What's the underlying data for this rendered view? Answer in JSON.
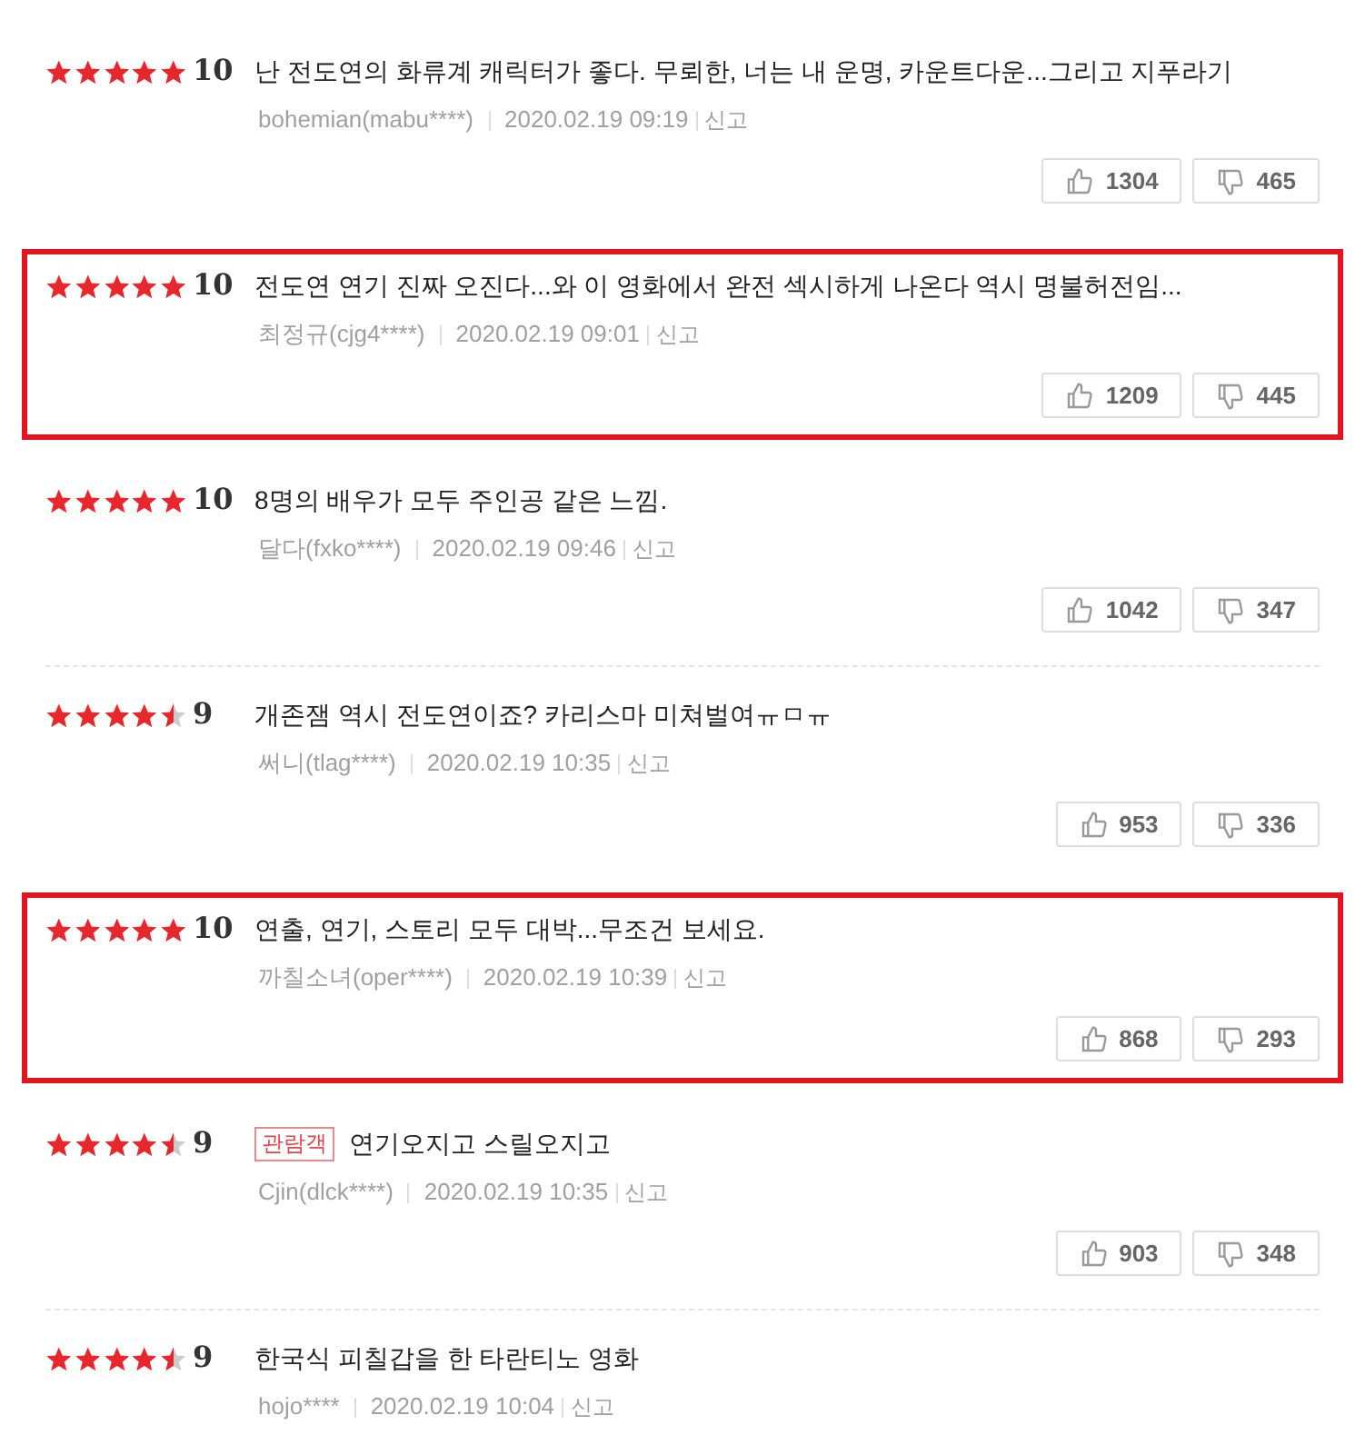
{
  "reviews": [
    {
      "stars": 5,
      "score": "10",
      "highlighted": false,
      "text": "난 전도연의 화류계 캐릭터가 좋다. 무뢰한, 너는 내 운명, 카운트다운...그리고 지푸라기",
      "author": "bohemian(mabu****)",
      "date": "2020.02.19 09:19",
      "report": "신고",
      "up": "1304",
      "down": "465"
    },
    {
      "stars": 5,
      "score": "10",
      "highlighted": true,
      "text": "전도연 연기 진짜 오진다...와 이 영화에서 완전 섹시하게 나온다 역시 명불허전임...",
      "author": "최정규(cjg4****)",
      "date": "2020.02.19 09:01",
      "report": "신고",
      "up": "1209",
      "down": "445"
    },
    {
      "stars": 5,
      "score": "10",
      "highlighted": false,
      "text": "8명의 배우가 모두 주인공 같은 느낌.",
      "author": "달다(fxko****)",
      "date": "2020.02.19 09:46",
      "report": "신고",
      "up": "1042",
      "down": "347"
    },
    {
      "stars": 4.5,
      "score": "9",
      "highlighted": false,
      "text": "개존잼 역시 전도연이죠? 카리스마 미쳐벌여ㅠㅁㅠ",
      "author": "써니(tlag****)",
      "date": "2020.02.19 10:35",
      "report": "신고",
      "up": "953",
      "down": "336"
    },
    {
      "stars": 5,
      "score": "10",
      "highlighted": true,
      "text": "연출, 연기, 스토리 모두 대박...무조건 보세요.",
      "author": "까칠소녀(oper****)",
      "date": "2020.02.19 10:39",
      "report": "신고",
      "up": "868",
      "down": "293"
    },
    {
      "stars": 4.5,
      "score": "9",
      "highlighted": false,
      "badge": "관람객",
      "text": "연기오지고 스릴오지고",
      "author": "Cjin(dlck****)",
      "date": "2020.02.19 10:35",
      "report": "신고",
      "up": "903",
      "down": "348"
    },
    {
      "stars": 4.5,
      "score": "9",
      "highlighted": false,
      "text": "한국식 피칠갑을 한 타란티노 영화",
      "author": "hojo****",
      "date": "2020.02.19 10:04",
      "report": "신고"
    }
  ]
}
